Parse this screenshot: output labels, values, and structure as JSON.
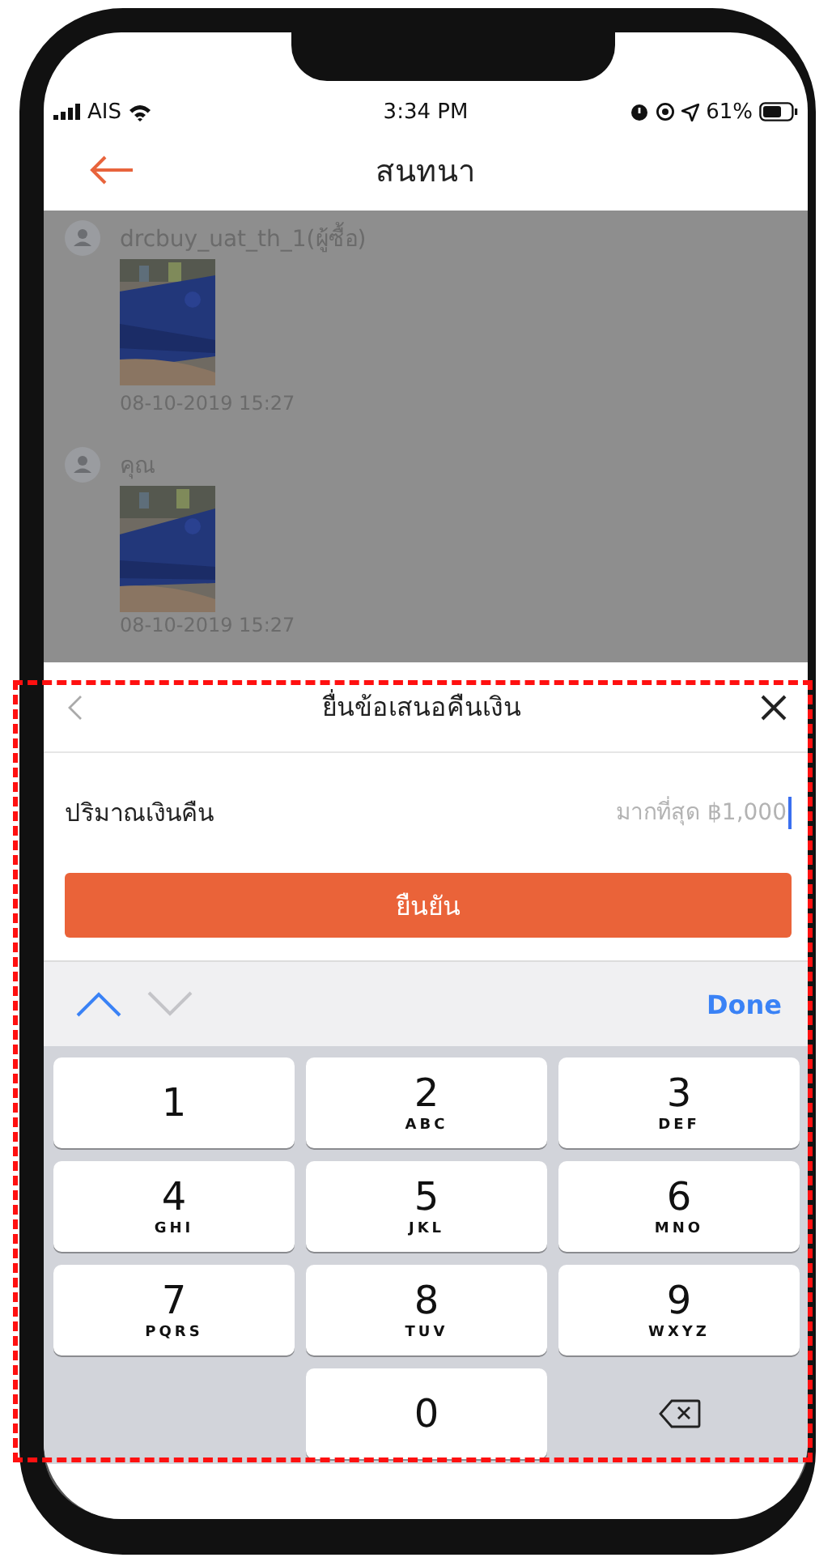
{
  "status_bar": {
    "carrier": "AIS",
    "time": "3:34 PM",
    "battery": "61%"
  },
  "nav": {
    "title": "สนทนา"
  },
  "messages": [
    {
      "sender": "drcbuy_uat_th_1(ผู้ซื้อ)",
      "time": "08-10-2019 15:27"
    },
    {
      "sender": "คุณ",
      "time": "08-10-2019 15:27"
    }
  ],
  "sheet": {
    "title": "ยื่นข้อเสนอคืนเงิน",
    "amount": {
      "label": "ปริมาณเงินคืน",
      "placeholder": "มากที่สุด ฿1,000"
    },
    "confirm": "ยืนยัน"
  },
  "keyboard_toolbar": {
    "previous_disabled": false,
    "next_disabled": true,
    "done": "Done"
  },
  "keypad": [
    {
      "kind": "digit",
      "digit": "1"
    },
    {
      "kind": "digit",
      "digit": "2",
      "letters": "ABC"
    },
    {
      "kind": "digit",
      "digit": "3",
      "letters": "DEF"
    },
    {
      "kind": "digit",
      "digit": "4",
      "letters": "GHI"
    },
    {
      "kind": "digit",
      "digit": "5",
      "letters": "JKL"
    },
    {
      "kind": "digit",
      "digit": "6",
      "letters": "MNO"
    },
    {
      "kind": "digit",
      "digit": "7",
      "letters": "PQRS"
    },
    {
      "kind": "digit",
      "digit": "8",
      "letters": "TUV"
    },
    {
      "kind": "digit",
      "digit": "9",
      "letters": "WXYZ"
    },
    {
      "kind": "blank"
    },
    {
      "kind": "digit",
      "digit": "0"
    },
    {
      "kind": "delete"
    }
  ]
}
